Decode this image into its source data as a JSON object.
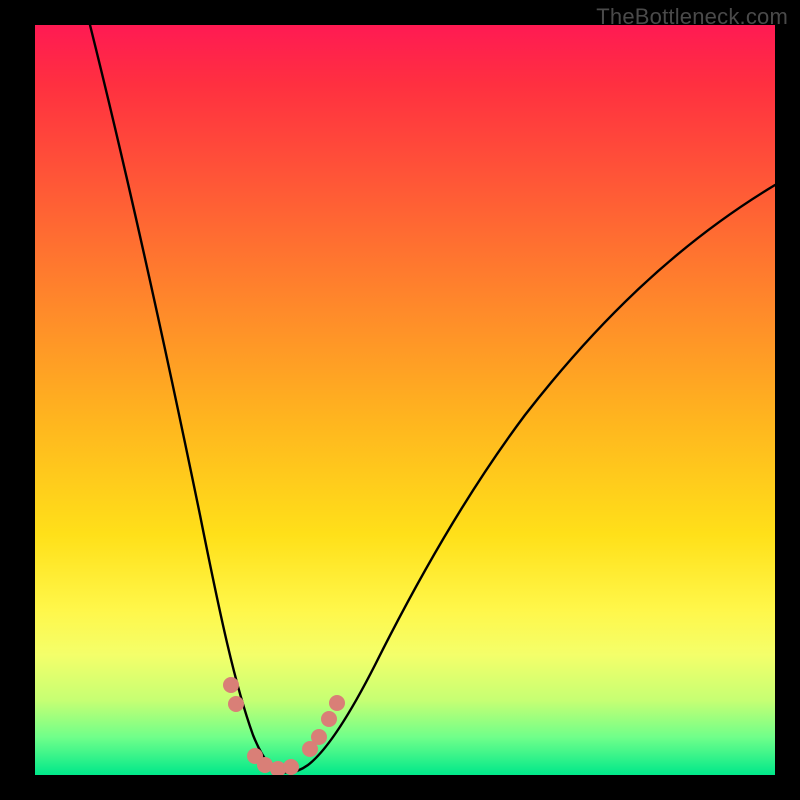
{
  "watermark": "TheBottleneck.com",
  "chart_data": {
    "type": "line",
    "title": "",
    "xlabel": "",
    "ylabel": "",
    "ylim": [
      0,
      100
    ],
    "x": [
      0.0,
      0.05,
      0.1,
      0.15,
      0.2,
      0.225,
      0.25,
      0.27,
      0.29,
      0.3,
      0.31,
      0.32,
      0.34,
      0.36,
      0.4,
      0.45,
      0.5,
      0.55,
      0.6,
      0.7,
      0.8,
      0.9,
      1.0
    ],
    "values": [
      100,
      85,
      70,
      55,
      38,
      28,
      18,
      10,
      4,
      1,
      0,
      0,
      1,
      3,
      8,
      15,
      22,
      28,
      34,
      44,
      52,
      58,
      63
    ],
    "series": [
      {
        "name": "bottleneck-curve",
        "x": [
          0.0,
          0.05,
          0.1,
          0.15,
          0.2,
          0.225,
          0.25,
          0.27,
          0.29,
          0.3,
          0.31,
          0.32,
          0.34,
          0.36,
          0.4,
          0.45,
          0.5,
          0.55,
          0.6,
          0.7,
          0.8,
          0.9,
          1.0
        ],
        "y": [
          100,
          85,
          70,
          55,
          38,
          28,
          18,
          10,
          4,
          1,
          0,
          0,
          1,
          3,
          8,
          15,
          22,
          28,
          34,
          44,
          52,
          58,
          63
        ]
      }
    ],
    "markers": {
      "color": "#d97f77",
      "points": [
        {
          "x": 0.258,
          "y": 13
        },
        {
          "x": 0.265,
          "y": 10
        },
        {
          "x": 0.295,
          "y": 2
        },
        {
          "x": 0.305,
          "y": 1
        },
        {
          "x": 0.32,
          "y": 1
        },
        {
          "x": 0.335,
          "y": 1.5
        },
        {
          "x": 0.36,
          "y": 4
        },
        {
          "x": 0.372,
          "y": 6
        },
        {
          "x": 0.388,
          "y": 9
        },
        {
          "x": 0.4,
          "y": 11
        }
      ]
    },
    "gradient_meaning": "red = high bottleneck, green = no bottleneck"
  }
}
